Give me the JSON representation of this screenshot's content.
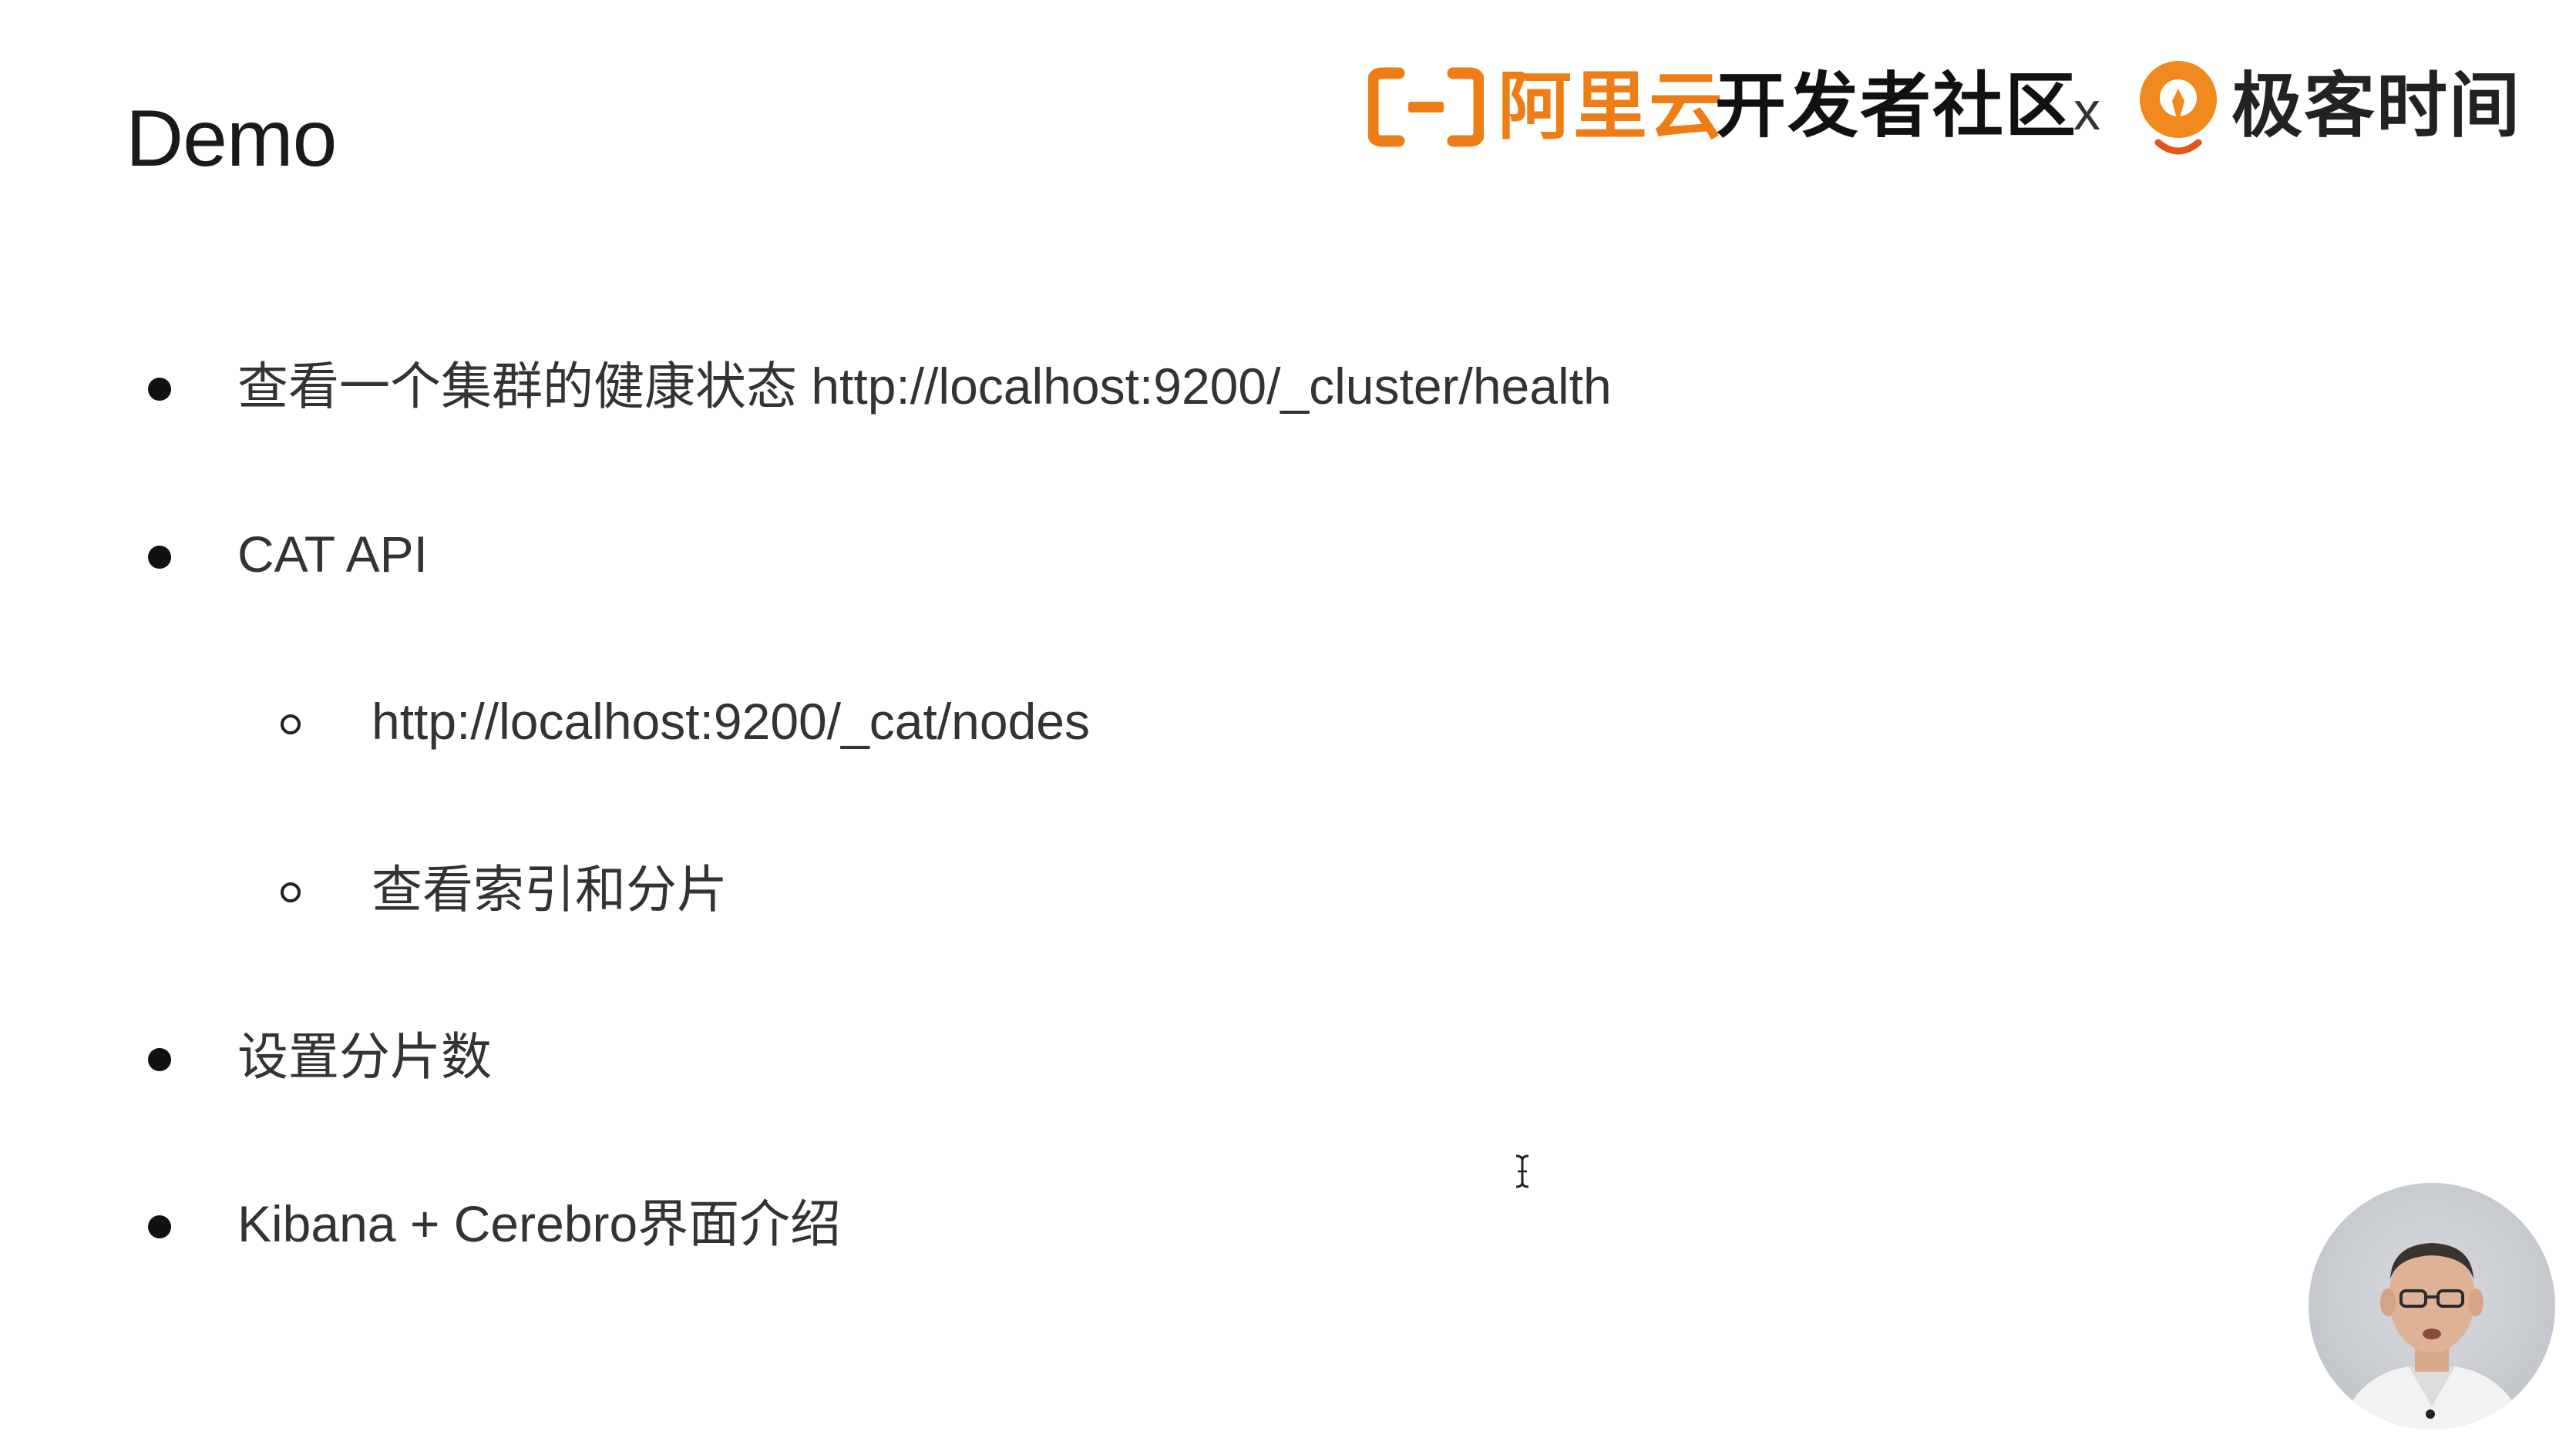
{
  "slide": {
    "title": "Demo",
    "header": {
      "aliyun_brand": "阿里云",
      "community_label": "开发者社区",
      "separator": "x",
      "geek_brand": "极客时间",
      "colors": {
        "aliyun_orange": "#ef7d16",
        "geek_orange": "#f08a1e"
      }
    },
    "bullets": [
      {
        "level": 1,
        "marker": "filled-circle",
        "text": "查看一个集群的健康状态 http://localhost:9200/_cluster/health"
      },
      {
        "level": 1,
        "marker": "filled-circle",
        "text": "CAT API"
      },
      {
        "level": 2,
        "marker": "hollow-circle",
        "text": " http://localhost:9200/_cat/nodes"
      },
      {
        "level": 2,
        "marker": "hollow-circle",
        "text": "查看索引和分片"
      },
      {
        "level": 1,
        "marker": "filled-circle",
        "text": "设置分片数"
      },
      {
        "level": 1,
        "marker": "filled-circle",
        "text": "Kibana + Cerebro界面介绍"
      }
    ],
    "cursor": "text-cursor-icon",
    "presenter": "presenter-webcam"
  }
}
